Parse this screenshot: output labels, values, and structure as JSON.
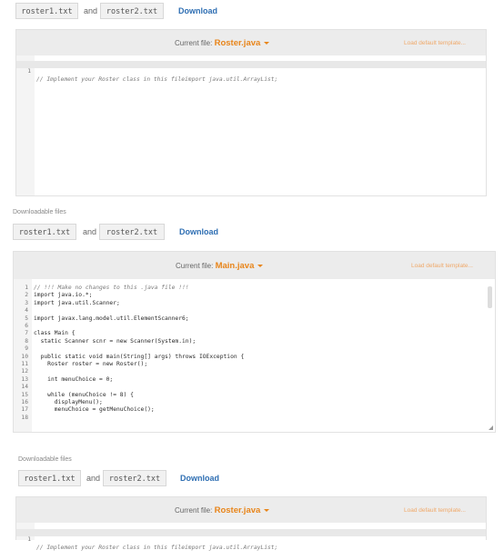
{
  "section1": {
    "files": [
      "roster1.txt",
      "roster2.txt"
    ],
    "and_label": "and",
    "download_label": "Download",
    "current_file_label": "Current file:",
    "current_file": "Roster.java",
    "load_default": "Load default template...",
    "code": [
      {
        "n": "1",
        "t": "// Implement your Roster class in this fileimport java.util.ArrayList;"
      }
    ]
  },
  "section2": {
    "header": "Downloadable files",
    "files": [
      "roster1.txt",
      "roster2.txt"
    ],
    "and_label": "and",
    "download_label": "Download",
    "current_file_label": "Current file:",
    "current_file": "Main.java",
    "load_default": "Load default template...",
    "code": [
      {
        "n": "1",
        "t": "// !!! Make no changes to this .java file !!!"
      },
      {
        "n": "2",
        "t": "import java.io.*;"
      },
      {
        "n": "3",
        "t": "import java.util.Scanner;"
      },
      {
        "n": "4",
        "t": ""
      },
      {
        "n": "5",
        "t": "import javax.lang.model.util.ElementScanner6;"
      },
      {
        "n": "6",
        "t": ""
      },
      {
        "n": "7",
        "t": "class Main {"
      },
      {
        "n": "8",
        "t": "  static Scanner scnr = new Scanner(System.in);"
      },
      {
        "n": "9",
        "t": ""
      },
      {
        "n": "10",
        "t": "  public static void main(String[] args) throws IOException {"
      },
      {
        "n": "11",
        "t": "    Roster roster = new Roster();"
      },
      {
        "n": "12",
        "t": ""
      },
      {
        "n": "13",
        "t": "    int menuChoice = 0;"
      },
      {
        "n": "14",
        "t": ""
      },
      {
        "n": "15",
        "t": "    while (menuChoice != 8) {"
      },
      {
        "n": "16",
        "t": "      displayMenu();"
      },
      {
        "n": "17",
        "t": "      menuChoice = getMenuChoice();"
      },
      {
        "n": "18",
        "t": ""
      }
    ]
  },
  "section3": {
    "header": "Downloadable files",
    "files": [
      "roster1.txt",
      "roster2.txt"
    ],
    "and_label": "and",
    "download_label": "Download",
    "current_file_label": "Current file:",
    "current_file": "Roster.java",
    "load_default": "Load default template...",
    "code": [
      {
        "n": "1",
        "t": "// Implement your Roster class in this fileimport java.util.ArrayList;"
      }
    ]
  },
  "colors": {
    "accent": "#e8851a",
    "link": "#2f6fb3",
    "bar": "#ececec"
  }
}
